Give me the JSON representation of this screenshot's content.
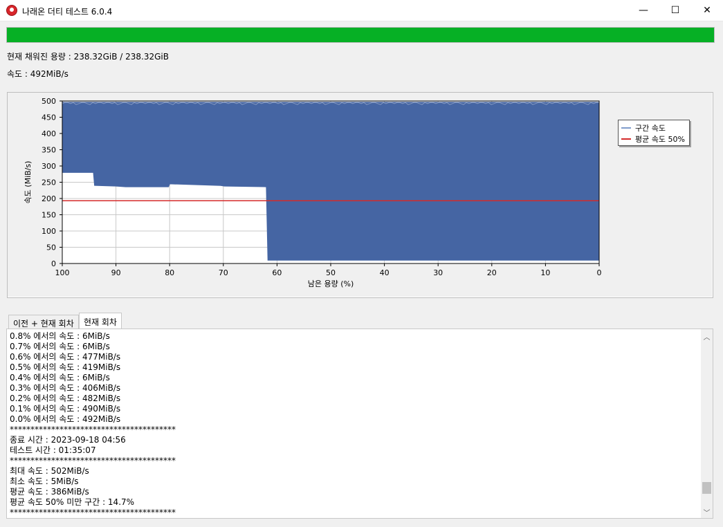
{
  "window": {
    "title": "나래온 더티 테스트 6.0.4",
    "min_glyph": "—",
    "max_glyph": "☐",
    "close_glyph": "✕"
  },
  "progress": {
    "value": 1.0,
    "color": "#06b025"
  },
  "status": {
    "filled_capacity": "현재 채워진 용량 : 238.32GiB / 238.32GiB",
    "speed": "속도 : 492MiB/s"
  },
  "chart_data": {
    "type": "area",
    "xlabel": "남은 용량 (%)",
    "ylabel": "속도 (MiB/s)",
    "xlim": [
      100,
      0
    ],
    "ylim": [
      0,
      500
    ],
    "x_ticks": [
      "100",
      "90",
      "80",
      "70",
      "60",
      "50",
      "40",
      "30",
      "20",
      "10",
      "0"
    ],
    "y_ticks": [
      "500",
      "450",
      "400",
      "350",
      "300",
      "250",
      "200",
      "150",
      "100",
      "50",
      "0"
    ],
    "grid": true,
    "legend_position": "top-right",
    "series": [
      {
        "name": "구간 속도",
        "color": "#4565a3",
        "band_max": [
          [
            100,
            496
          ],
          [
            0,
            496
          ]
        ],
        "band_min": [
          [
            100,
            280
          ],
          [
            94.2,
            280
          ],
          [
            94.0,
            240
          ],
          [
            90.0,
            238
          ],
          [
            88.2,
            236
          ],
          [
            80.2,
            236
          ],
          [
            80.0,
            245
          ],
          [
            70.5,
            240
          ],
          [
            69.8,
            238
          ],
          [
            62.0,
            236
          ],
          [
            61.7,
            10
          ],
          [
            0,
            10
          ]
        ]
      },
      {
        "name": "평균 속도 50%",
        "color": "#d42a2a",
        "values": [
          [
            100,
            193
          ],
          [
            0,
            193
          ]
        ]
      }
    ]
  },
  "legend": {
    "items": [
      {
        "label": "구간 속도",
        "color": "#7f9ccb"
      },
      {
        "label": "평균 속도 50%",
        "color": "#d42a2a"
      }
    ]
  },
  "tabs": [
    {
      "label": "이전 + 현재 회차"
    },
    {
      "label": "현재 회차"
    }
  ],
  "log": {
    "lines": [
      "0.8% 에서의 속도 : 6MiB/s",
      "0.7% 에서의 속도 : 6MiB/s",
      "0.6% 에서의 속도 : 477MiB/s",
      "0.5% 에서의 속도 : 419MiB/s",
      "0.4% 에서의 속도 : 6MiB/s",
      "0.3% 에서의 속도 : 406MiB/s",
      "0.2% 에서의 속도 : 482MiB/s",
      "0.1% 에서의 속도 : 490MiB/s",
      "0.0% 에서의 속도 : 492MiB/s",
      "****************************************",
      "종료 시간 : 2023-09-18 04:56",
      "테스트 시간 : 01:35:07",
      "****************************************",
      "최대 속도 : 502MiB/s",
      "최소 속도 : 5MiB/s",
      "평균 속도 : 386MiB/s",
      "평균 속도 50% 미만 구간 : 14.7%",
      "****************************************"
    ]
  },
  "scrollbar": {
    "up_glyph": "︿",
    "down_glyph": "﹀",
    "position": 0.92
  }
}
